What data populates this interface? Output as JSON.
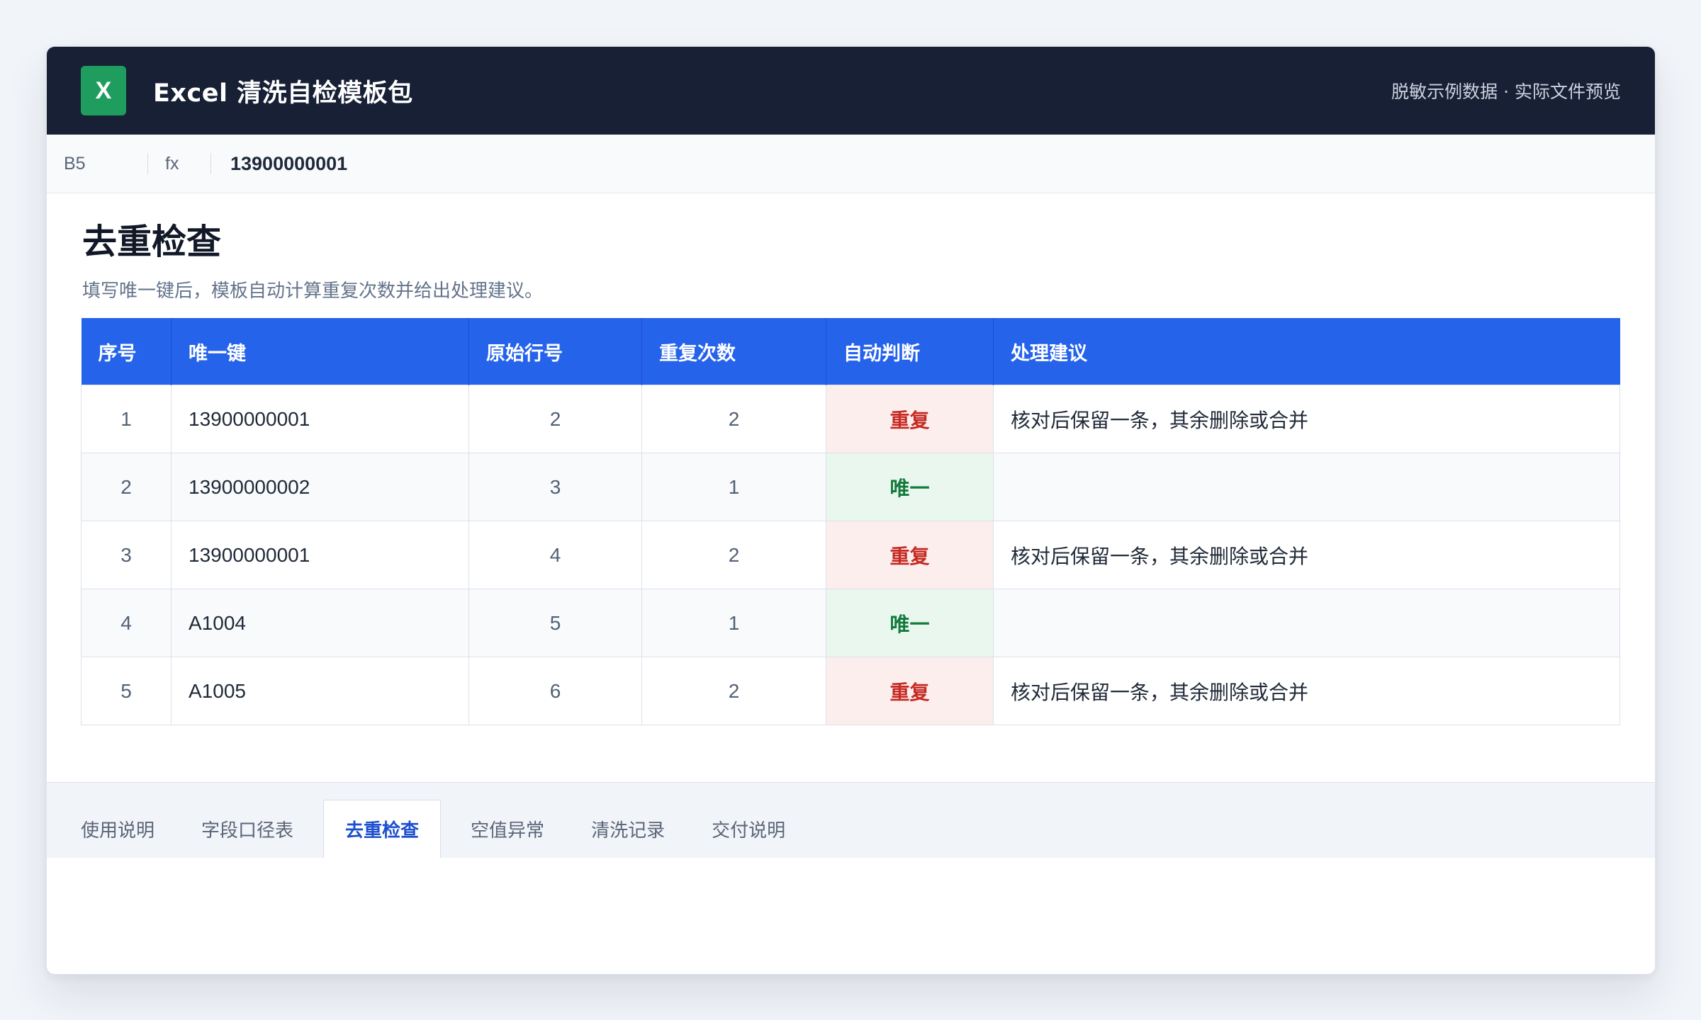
{
  "app": {
    "logo": "X",
    "title": "Excel 清洗自检模板包",
    "note": "脱敏示例数据 · 实际文件预览"
  },
  "formula_bar": {
    "cell_ref": "B5",
    "fx_label": "fx",
    "value": "13900000001"
  },
  "sheet": {
    "title": "去重检查",
    "subtitle": "填写唯一键后，模板自动计算重复次数并给出处理建议。",
    "columns": [
      "序号",
      "唯一键",
      "原始行号",
      "重复次数",
      "自动判断",
      "处理建议"
    ],
    "rows": [
      {
        "index": "1",
        "key": "13900000001",
        "source_row": "2",
        "dup_count": "2",
        "status": "重复",
        "status_type": "dup",
        "advice": "核对后保留一条，其余删除或合并"
      },
      {
        "index": "2",
        "key": "13900000002",
        "source_row": "3",
        "dup_count": "1",
        "status": "唯一",
        "status_type": "uniq",
        "advice": ""
      },
      {
        "index": "3",
        "key": "13900000001",
        "source_row": "4",
        "dup_count": "2",
        "status": "重复",
        "status_type": "dup",
        "advice": "核对后保留一条，其余删除或合并"
      },
      {
        "index": "4",
        "key": "A1004",
        "source_row": "5",
        "dup_count": "1",
        "status": "唯一",
        "status_type": "uniq",
        "advice": ""
      },
      {
        "index": "5",
        "key": "A1005",
        "source_row": "6",
        "dup_count": "2",
        "status": "重复",
        "status_type": "dup",
        "advice": "核对后保留一条，其余删除或合并"
      }
    ]
  },
  "tabs": [
    {
      "label": "使用说明",
      "active": false
    },
    {
      "label": "字段口径表",
      "active": false
    },
    {
      "label": "去重检查",
      "active": true
    },
    {
      "label": "空值异常",
      "active": false
    },
    {
      "label": "清洗记录",
      "active": false
    },
    {
      "label": "交付说明",
      "active": false
    }
  ],
  "colors": {
    "titlebar_bg": "#182035",
    "logo_green": "#1f9d5f",
    "header_blue": "#2563eb",
    "dup_red": "#c52a22",
    "uniq_green": "#137a3d"
  }
}
